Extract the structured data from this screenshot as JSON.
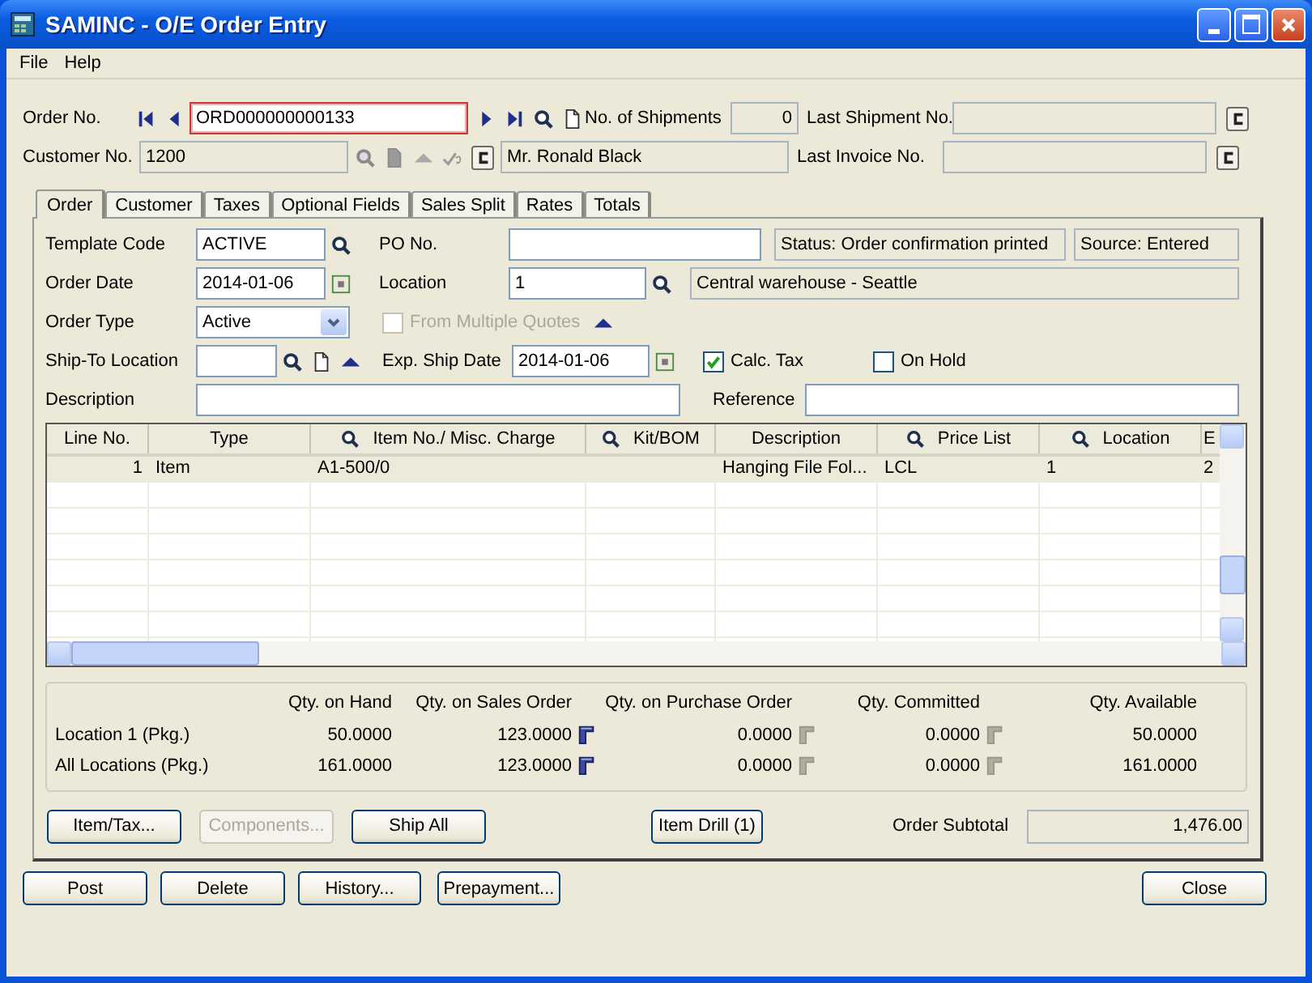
{
  "window": {
    "title": "SAMINC - O/E Order Entry"
  },
  "menu": [
    "File",
    "Help"
  ],
  "header": {
    "order_no": {
      "label": "Order No.",
      "value": "ORD000000000133"
    },
    "shipments": {
      "label": "No. of Shipments",
      "value": "0"
    },
    "last_shipment": {
      "label": "Last Shipment No."
    },
    "customer_no": {
      "label": "Customer No.",
      "value": "1200"
    },
    "customer_name": {
      "value": "Mr. Ronald Black"
    },
    "last_invoice": {
      "label": "Last Invoice No."
    }
  },
  "tabs": [
    {
      "label": "Order",
      "selected": true
    },
    {
      "label": "Customer",
      "selected": false
    },
    {
      "label": "Taxes",
      "selected": false
    },
    {
      "label": "Optional Fields",
      "selected": false
    },
    {
      "label": "Sales Split",
      "selected": false
    },
    {
      "label": "Rates",
      "selected": false
    },
    {
      "label": "Totals",
      "selected": false
    }
  ],
  "order_form": {
    "template_code": {
      "label": "Template Code",
      "value": "ACTIVE"
    },
    "po_no": {
      "label": "PO No."
    },
    "status": {
      "value": "Status: Order confirmation printed"
    },
    "source": {
      "value": "Source: Entered"
    },
    "order_date": {
      "label": "Order Date",
      "value": "2014-01-06"
    },
    "location": {
      "label": "Location",
      "value": "1"
    },
    "location_desc": {
      "value": "Central warehouse - Seattle"
    },
    "order_type": {
      "label": "Order Type",
      "value": "Active"
    },
    "from_multiple_quotes": {
      "label": "From Multiple Quotes",
      "checked": false,
      "disabled": true
    },
    "ship_to": {
      "label": "Ship-To Location"
    },
    "exp_ship_date": {
      "label": "Exp. Ship Date",
      "value": "2014-01-06"
    },
    "calc_tax": {
      "label": "Calc. Tax",
      "checked": true,
      "disabled": false
    },
    "on_hold": {
      "label": "On Hold",
      "checked": false,
      "disabled": false
    },
    "description": {
      "label": "Description"
    },
    "reference": {
      "label": "Reference"
    }
  },
  "lines": {
    "columns": [
      {
        "label": "Line No.",
        "search": false
      },
      {
        "label": "Type",
        "search": false
      },
      {
        "label": "Item No./ Misc. Charge",
        "search": true
      },
      {
        "label": "Kit/BOM",
        "search": true
      },
      {
        "label": "Description",
        "search": false
      },
      {
        "label": "Price List",
        "search": true
      },
      {
        "label": "Location",
        "search": true
      },
      {
        "label": "E",
        "search": false
      }
    ],
    "rows": [
      {
        "selected": true,
        "cells": [
          "1",
          "Item",
          "A1-500/0",
          null,
          "Hanging File Fol...",
          "LCL",
          "1",
          "2"
        ]
      }
    ]
  },
  "quantities": {
    "columns": [
      "Qty. on Hand",
      "Qty. on Sales Order",
      "Qty. on Purchase Order",
      "Qty. Committed",
      "Qty. Available"
    ],
    "rows": [
      {
        "label": "Location 1 (Pkg.)",
        "values": [
          {
            "text": "50.0000"
          },
          {
            "text": "123.0000",
            "drill": {
              "disabled": false
            }
          },
          {
            "text": "0.0000",
            "drill": {
              "disabled": true
            }
          },
          {
            "text": "0.0000",
            "drill": {
              "disabled": true
            }
          },
          {
            "text": "50.0000"
          }
        ]
      },
      {
        "label": "All Locations (Pkg.)",
        "values": [
          {
            "text": "161.0000"
          },
          {
            "text": "123.0000",
            "drill": {
              "disabled": false
            }
          },
          {
            "text": "0.0000",
            "drill": {
              "disabled": true
            }
          },
          {
            "text": "0.0000",
            "drill": {
              "disabled": true
            }
          },
          {
            "text": "161.0000"
          }
        ]
      }
    ]
  },
  "actions": [
    {
      "label": "Item/Tax...",
      "disabled": false
    },
    {
      "label": "Components...",
      "disabled": true
    },
    {
      "label": "Ship All",
      "disabled": false
    }
  ],
  "item_drill": {
    "label": "Item Drill (1)",
    "disabled": false
  },
  "order_subtotal": {
    "label": "Order Subtotal",
    "value": "1,476.00"
  },
  "footer": {
    "buttons": [
      "Post",
      "Delete",
      "History...",
      "Prepayment..."
    ],
    "close": "Close"
  }
}
